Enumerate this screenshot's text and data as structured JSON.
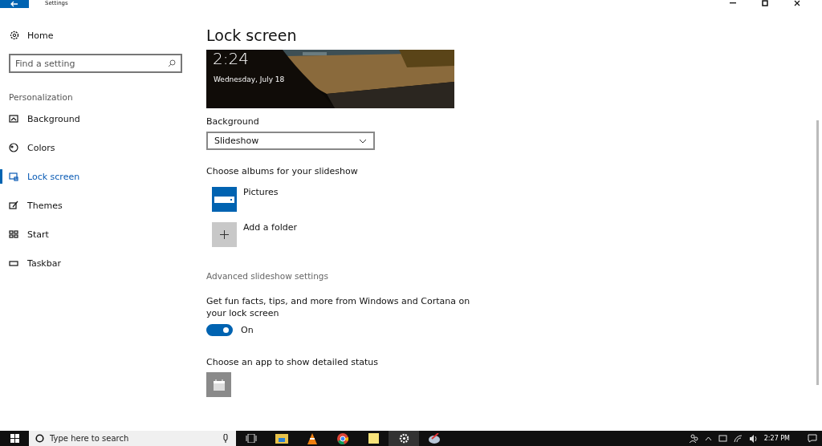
{
  "window": {
    "title": "Settings"
  },
  "sidebar": {
    "home": "Home",
    "search": {
      "placeholder": "Find a setting"
    },
    "section": "Personalization",
    "items": [
      {
        "label": "Background",
        "kind": "background",
        "selected": false
      },
      {
        "label": "Colors",
        "kind": "colors",
        "selected": false
      },
      {
        "label": "Lock screen",
        "kind": "lock",
        "selected": true
      },
      {
        "label": "Themes",
        "kind": "themes",
        "selected": false
      },
      {
        "label": "Start",
        "kind": "start",
        "selected": false
      },
      {
        "label": "Taskbar",
        "kind": "taskbar",
        "selected": false
      }
    ]
  },
  "page": {
    "title": "Lock screen",
    "preview": {
      "time": "2:24",
      "date": "Wednesday, July 18"
    },
    "background": {
      "label": "Background",
      "value": "Slideshow"
    },
    "albums": {
      "label": "Choose albums for your slideshow",
      "items": [
        {
          "label": "Pictures",
          "kind": "album"
        },
        {
          "label": "Add a folder",
          "kind": "add"
        }
      ]
    },
    "advanced_link": "Advanced slideshow settings",
    "fun_facts": {
      "label": "Get fun facts, tips, and more from Windows and Cortana on your lock screen",
      "on": true,
      "state_text": "On"
    },
    "detailed_status": {
      "label": "Choose an app to show detailed status"
    }
  },
  "taskbar": {
    "search": {
      "placeholder": "Type here to search"
    },
    "time": "2:27 PM"
  }
}
